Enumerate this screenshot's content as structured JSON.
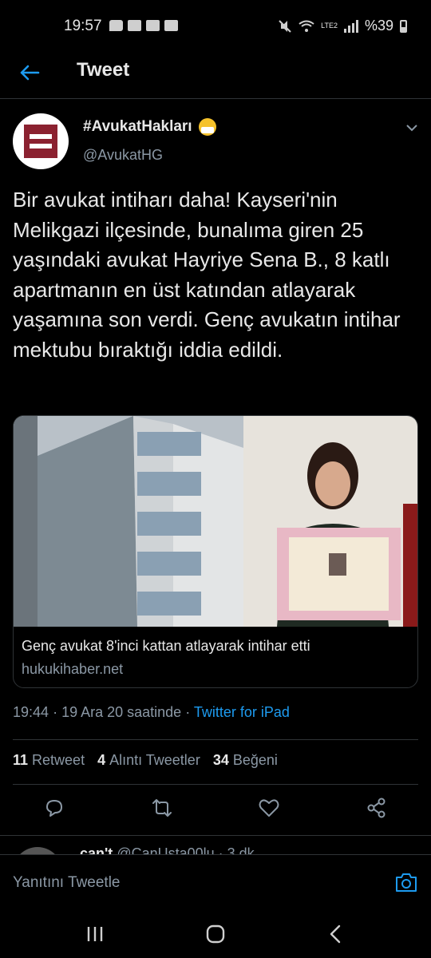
{
  "status_bar": {
    "time": "19:57",
    "battery": "%39",
    "network": "LTE2"
  },
  "header": {
    "title": "Tweet"
  },
  "tweet": {
    "author_name": "#AvukatHakları",
    "author_handle": "@AvukatHG",
    "text": "Bir avukat intiharı daha! Kayseri'nin Melikgazi ilçesinde, bunalıma giren 25 yaşındaki avukat Hayriye Sena B., 8 katlı apartmanın en üst katından atlayarak yaşamına son verdi. Genç avukatın intihar mektubu bıraktığı iddia edildi.",
    "card": {
      "title": "Genç avukat 8'inci kattan atlayarak intihar etti",
      "domain": "hukukihaber.net"
    },
    "time": "19:44",
    "date": "19 Ara 20 saatinde",
    "source": "Twitter for iPad",
    "stats": {
      "retweets_count": "11",
      "retweets_label": "Retweet",
      "quotes_count": "4",
      "quotes_label": "Alıntı Tweetler",
      "likes_count": "34",
      "likes_label": "Beğeni"
    }
  },
  "next_reply": {
    "name": "can't",
    "handle": "@CanUsta00lu · 3 dk"
  },
  "reply_bar": {
    "placeholder": "Yanıtını Tweetle"
  },
  "colors": {
    "accent": "#1d9bf0",
    "background": "#000000",
    "secondary_text": "#8b98a5",
    "logo": "#8b2130"
  }
}
